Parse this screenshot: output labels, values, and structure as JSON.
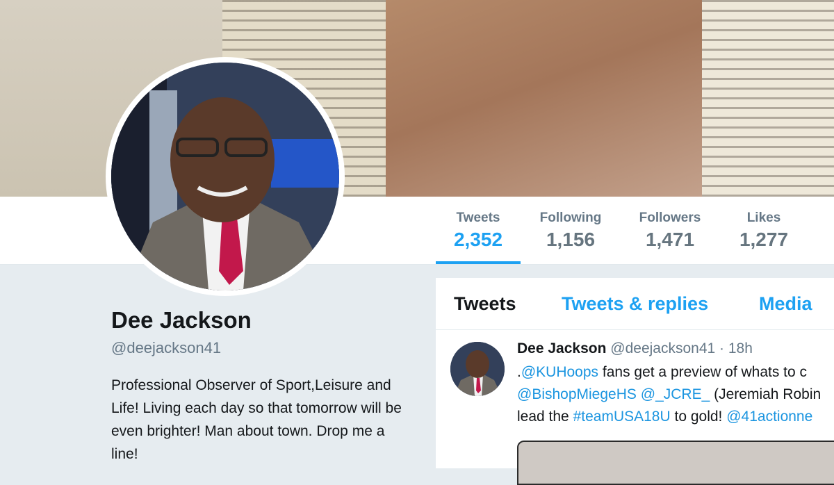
{
  "profile": {
    "name": "Dee Jackson",
    "handle": "@deejackson41",
    "bio": "Professional Observer of Sport,Leisure and Life! Living each day so that tomorrow will be even brighter! Man about town. Drop me a line!"
  },
  "stats": [
    {
      "label": "Tweets",
      "value": "2,352"
    },
    {
      "label": "Following",
      "value": "1,156"
    },
    {
      "label": "Followers",
      "value": "1,471"
    },
    {
      "label": "Likes",
      "value": "1,277"
    }
  ],
  "timeline": {
    "tabs": [
      "Tweets",
      "Tweets & replies",
      "Media"
    ]
  },
  "tweet": {
    "name": "Dee Jackson",
    "handle": "@deejackson41",
    "separator": "·",
    "time": "18h",
    "line1": {
      "prefix": ".",
      "link1": "@KUHoops",
      "text1": " fans get a preview of whats to c"
    },
    "line2": {
      "link1": "@BishopMiegeHS",
      "space": " ",
      "link2": "@_JCRE_",
      "text1": " (Jeremiah Robin"
    },
    "line3": {
      "text1": "lead the ",
      "link1": "#teamUSA18U",
      "text2": " to gold! ",
      "link2": "@41actionne"
    }
  },
  "colors": {
    "accent": "#1da1f2",
    "link": "#1b95e0",
    "background": "#e6ecf0",
    "text_primary": "#14171a",
    "text_secondary": "#657786"
  }
}
